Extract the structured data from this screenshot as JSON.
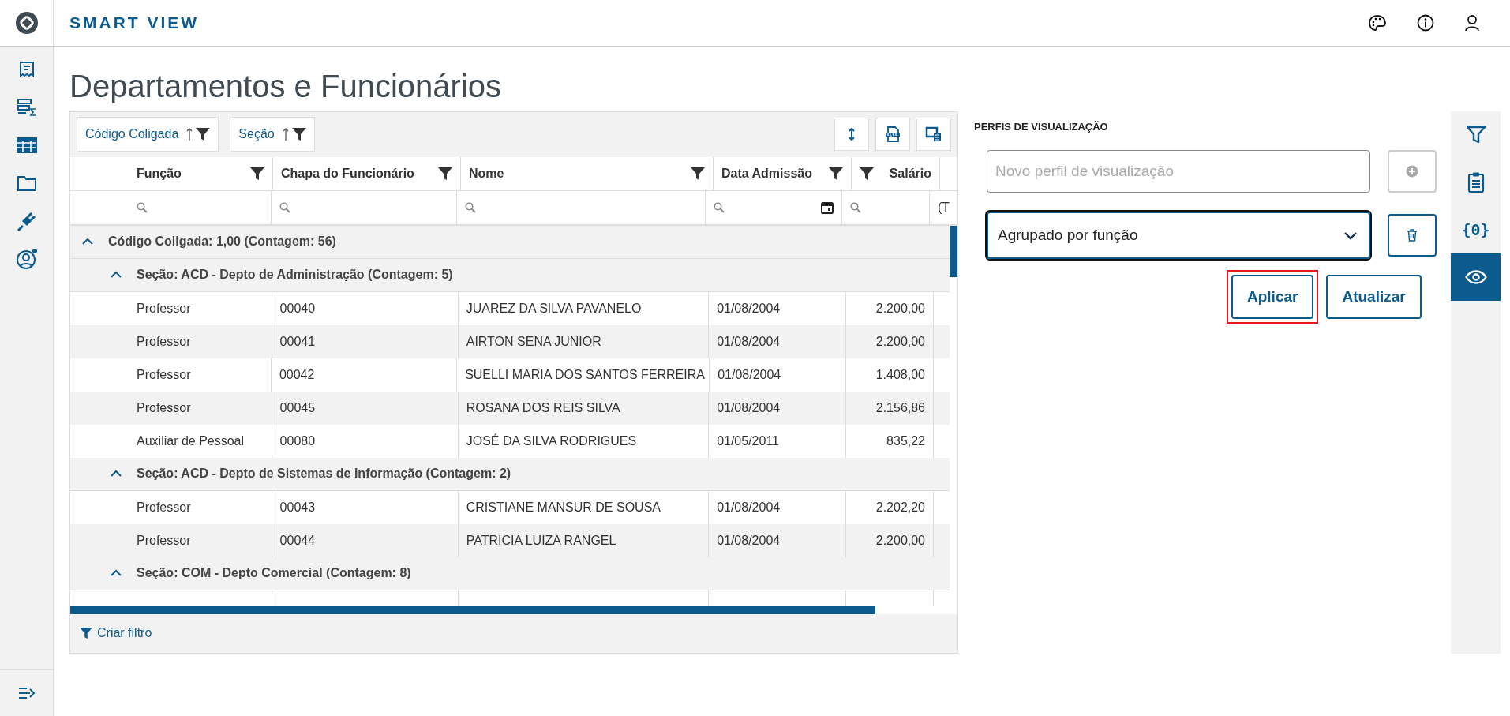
{
  "app": {
    "title": "SMART VIEW"
  },
  "nav": [
    {
      "selected": false
    },
    {
      "selected": false
    },
    {
      "selected": false
    },
    {
      "selected": false
    },
    {
      "selected": false
    },
    {
      "selected": false
    }
  ],
  "page": {
    "title": "Departamentos e Funcionários"
  },
  "grouping_chips": [
    {
      "label": "Código Coligada"
    },
    {
      "label": "Seção"
    }
  ],
  "table": {
    "columns": [
      {
        "label": "Função",
        "kind": "text"
      },
      {
        "label": "Chapa do Funcionário",
        "kind": "text"
      },
      {
        "label": "Nome",
        "kind": "text"
      },
      {
        "label": "Data Admissão",
        "kind": "date"
      },
      {
        "label": "Salário",
        "kind": "number"
      }
    ],
    "cut_column_filter": "(T",
    "groups": [
      {
        "label": "Código Coligada: 1,00 (Contagem: 56)",
        "expanded": true,
        "children": [
          {
            "label": "Seção: ACD - Depto de Administração (Contagem: 5)",
            "expanded": true,
            "rows": [
              [
                "Professor",
                "00040",
                "JUAREZ DA SILVA PAVANELO",
                "01/08/2004",
                "2.200,00"
              ],
              [
                "Professor",
                "00041",
                "AIRTON SENA JUNIOR",
                "01/08/2004",
                "2.200,00"
              ],
              [
                "Professor",
                "00042",
                "SUELLI MARIA DOS SANTOS FERREIRA",
                "01/08/2004",
                "1.408,00"
              ],
              [
                "Professor",
                "00045",
                "ROSANA DOS REIS SILVA",
                "01/08/2004",
                "2.156,86"
              ],
              [
                "Auxiliar de Pessoal",
                "00080",
                "JOSÉ DA SILVA RODRIGUES",
                "01/05/2011",
                "835,22"
              ]
            ]
          },
          {
            "label": "Seção: ACD - Depto de Sistemas de Informação (Contagem: 2)",
            "expanded": true,
            "rows": [
              [
                "Professor",
                "00043",
                "CRISTIANE MANSUR DE SOUSA",
                "01/08/2004",
                "2.202,20"
              ],
              [
                "Professor",
                "00044",
                "PATRICIA LUIZA RANGEL",
                "01/08/2004",
                "2.200,00"
              ]
            ]
          },
          {
            "label": "Seção: COM - Depto Comercial (Contagem: 8)",
            "expanded": true
          }
        ]
      }
    ]
  },
  "footer": {
    "link": "Criar filtro"
  },
  "profiles": {
    "title": "PERFIS DE VISUALIZAÇÃO",
    "new_placeholder": "Novo perfil de visualização",
    "add_disabled": true,
    "selected_profile": "Agrupado por função",
    "buttons": [
      {
        "label": "Aplicar",
        "highlighted": true
      },
      {
        "label": "Atualizar",
        "highlighted": false
      }
    ]
  },
  "side_tabs": [
    {
      "selected": false
    },
    {
      "selected": false
    },
    {
      "label": "{0}",
      "selected": false
    },
    {
      "selected": true
    }
  ]
}
